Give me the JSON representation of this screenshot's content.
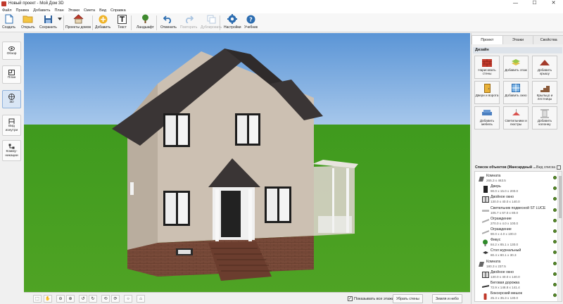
{
  "window": {
    "title": "Новый проект - Мой Дом 3D",
    "controls": [
      "—",
      "☐",
      "✕"
    ]
  },
  "menu": [
    "Файл",
    "Правка",
    "Добавить",
    "План",
    "Этажи",
    "Смета",
    "Вид",
    "Справка"
  ],
  "toolbar": {
    "create": "Создать",
    "open": "Открыть",
    "save": "Сохранить",
    "projects": "Проекты домов",
    "add": "Добавить",
    "text": "Текст",
    "landscape": "Ландшафт",
    "undo": "Отменить",
    "redo": "Повторить",
    "duplicate": "Дублировать",
    "settings": "Настройки",
    "tutorial": "Учебник"
  },
  "left_nav": {
    "overview": "Обзор",
    "plan": "План",
    "view3d": "3D",
    "inside": "Вид изнутри",
    "communications": "Комму-никации"
  },
  "bottom": {
    "show_all_floors": "Показывать все этажи",
    "hide_walls": "Убрать стены",
    "ground_sky": "Земля и небо"
  },
  "tabs": [
    "Проект",
    "Этажи",
    "Свойства"
  ],
  "design": {
    "title": "Дизайн",
    "items": [
      "Нарисовать стены",
      "Добавить этаж",
      "Добавить крышу",
      "Двери и ворота",
      "Добавить окно",
      "Крыльцо и лестницы",
      "Добавить мебель",
      "Светильники и люстры",
      "Добавить колонну"
    ]
  },
  "objects": {
    "title": "Список объектов (Мансардный ...",
    "view_label": "Вид списка",
    "items": [
      {
        "name": "Комната",
        "dims": "265.3 x 463.5",
        "icon": "room-icon",
        "level": 0
      },
      {
        "name": "Дверь",
        "dims": "90.0 x 15.0 x 200.0",
        "icon": "door-icon",
        "level": 1
      },
      {
        "name": "Двойное окно",
        "dims": "130.0 x 40.0 x 140.0",
        "icon": "window-icon",
        "level": 1
      },
      {
        "name": "Светильник подвесной ST LUCE",
        "dims": "105.7 x 67.0 x 80.0",
        "icon": "lamp-icon",
        "level": 1
      },
      {
        "name": "Ограждение",
        "dims": "270.0 x 4.0 x 100.0",
        "icon": "fence-icon",
        "level": 1
      },
      {
        "name": "Ограждение",
        "dims": "90.0 x 4.0 x 100.0",
        "icon": "fence-icon",
        "level": 1
      },
      {
        "name": "Фикус",
        "dims": "84.2 x 85.1 x 130.0",
        "icon": "plant-icon",
        "level": 1
      },
      {
        "name": "Стол журнальный",
        "dims": "80.4 x 80.1 x 30.3",
        "icon": "table-icon",
        "level": 1
      },
      {
        "name": "Комната",
        "dims": "180.3 x 237.5",
        "icon": "room-icon",
        "level": 0
      },
      {
        "name": "Двойное окно",
        "dims": "130.0 x 40.0 x 140.0",
        "icon": "window-icon",
        "level": 1
      },
      {
        "name": "Беговая дорожка",
        "dims": "72.9 x 148.8 x 141.4",
        "icon": "treadmill-icon",
        "level": 1
      },
      {
        "name": "Боксерский мешок",
        "dims": "25.3 x 35.3 x 130.0",
        "icon": "punching-bag-icon",
        "level": 1
      }
    ]
  }
}
